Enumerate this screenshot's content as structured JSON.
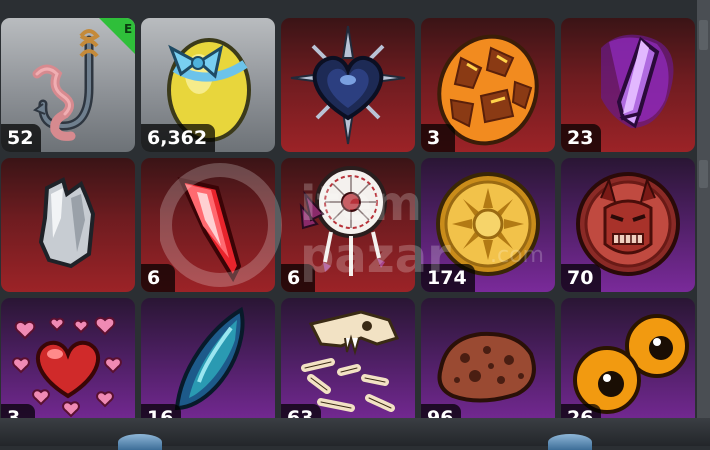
{
  "inventory": {
    "items": [
      {
        "name": "fishing-hook-worm",
        "count": "52",
        "bg": "gray",
        "equipped_badge": "E"
      },
      {
        "name": "ribbon-egg",
        "count": "6,362",
        "bg": "gray"
      },
      {
        "name": "spiked-dark-heart",
        "count": "",
        "bg": "red"
      },
      {
        "name": "lava-egg",
        "count": "3",
        "bg": "red"
      },
      {
        "name": "purple-crystal",
        "count": "23",
        "bg": "red"
      },
      {
        "name": "silver-ore",
        "count": "",
        "bg": "red"
      },
      {
        "name": "red-crystal",
        "count": "6",
        "bg": "red"
      },
      {
        "name": "dreamcatcher",
        "count": "6",
        "bg": "red"
      },
      {
        "name": "sun-coin",
        "count": "174",
        "bg": "purple"
      },
      {
        "name": "demon-coin",
        "count": "70",
        "bg": "purple"
      },
      {
        "name": "hearts",
        "count": "3",
        "bg": "purple"
      },
      {
        "name": "blue-seed",
        "count": "16",
        "bg": "purple"
      },
      {
        "name": "dinosaur-bones",
        "count": "63",
        "bg": "purple"
      },
      {
        "name": "cookie-rock",
        "count": "96",
        "bg": "purple"
      },
      {
        "name": "orange-eyes",
        "count": "26",
        "bg": "purple"
      }
    ]
  },
  "colors": {
    "gray_tile": "#8e9297",
    "red_tile": "#6e1c20",
    "purple_tile": "#4d1f63",
    "equip_badge": "#2fbf3a"
  }
}
